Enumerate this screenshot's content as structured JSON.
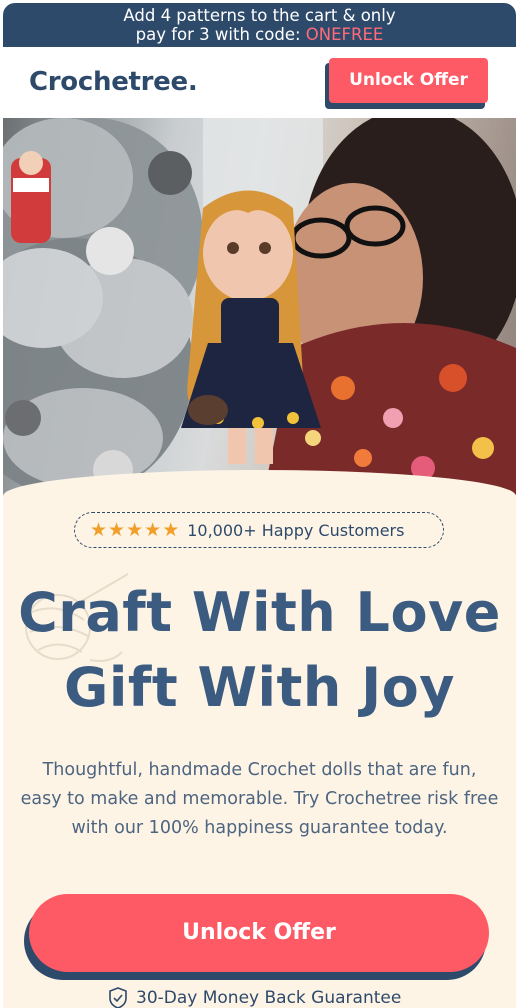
{
  "announcement": {
    "line1": "Add 4 patterns to the cart & only",
    "line2_prefix": "pay for 3 with code: ",
    "code": "ONEFREE"
  },
  "header": {
    "logo_text": "Crochetree.",
    "offer_button": "Unlock Offer"
  },
  "hero": {
    "image_icon": "photo-woman-holding-crochet-doll"
  },
  "rating": {
    "stars": 5,
    "text": "10,000+ Happy Customers"
  },
  "headline": {
    "line1": "Craft With Love",
    "line2": "Gift With Joy"
  },
  "body": "Thoughtful, handmade Crochet dolls that are fun, easy to make and memorable. Try Crochetree risk free with our 100% happiness guarantee today.",
  "cta": {
    "label": "Unlock Offer"
  },
  "guarantee": {
    "icon": "shield-check-icon",
    "text": "30-Day Money Back Guarantee"
  },
  "colors": {
    "navy": "#2e4a6b",
    "coral": "#fe5a66",
    "cream": "#fdf4e6",
    "star": "#f0a02a"
  }
}
